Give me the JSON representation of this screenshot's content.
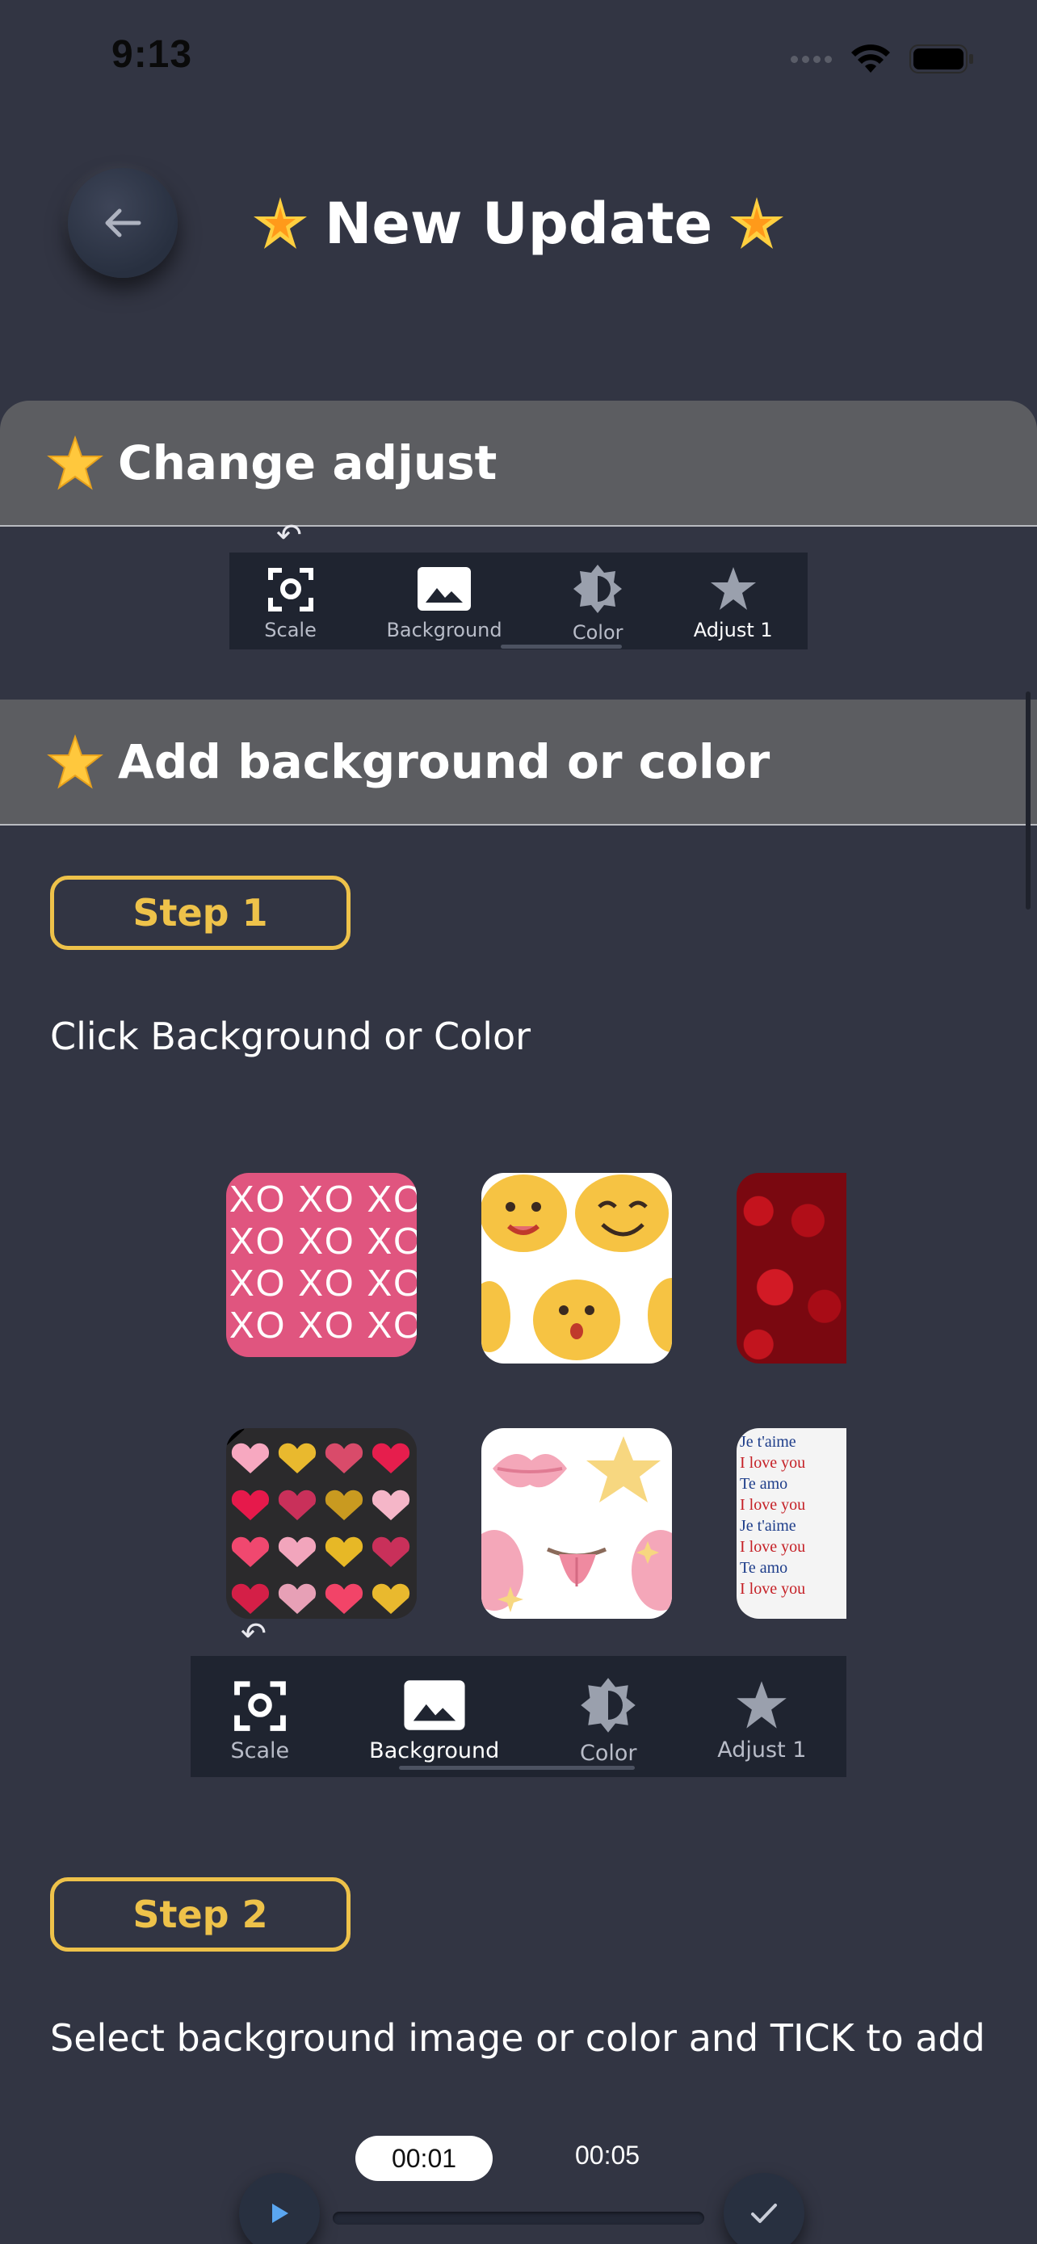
{
  "status_bar": {
    "time": "9:13"
  },
  "header": {
    "title": "New Update"
  },
  "sections": [
    {
      "title": "Change adjust"
    },
    {
      "title": "Add background or color"
    }
  ],
  "toolbar_small": {
    "items": [
      {
        "label": "Scale"
      },
      {
        "label": "Background"
      },
      {
        "label": "Color"
      },
      {
        "label": "Adjust 1"
      }
    ]
  },
  "steps": [
    {
      "badge": "Step 1",
      "text": "Click Background or Color"
    },
    {
      "badge": "Step 2",
      "text": "Select background image or color and TICK to add"
    }
  ],
  "thumbnails": {
    "xo_text": "XO",
    "love_text": [
      "Je t'aime",
      "I love you",
      "Te amo"
    ]
  },
  "toolbar_large": {
    "items": [
      {
        "label": "Scale"
      },
      {
        "label": "Background"
      },
      {
        "label": "Color"
      },
      {
        "label": "Adjust 1"
      }
    ]
  },
  "player": {
    "current_time": "00:01",
    "end_time": "00:05"
  },
  "colors": {
    "background": "#323543",
    "accent": "#eec24a",
    "section_header": "#5c5d61",
    "toolbar": "#1f2430"
  }
}
